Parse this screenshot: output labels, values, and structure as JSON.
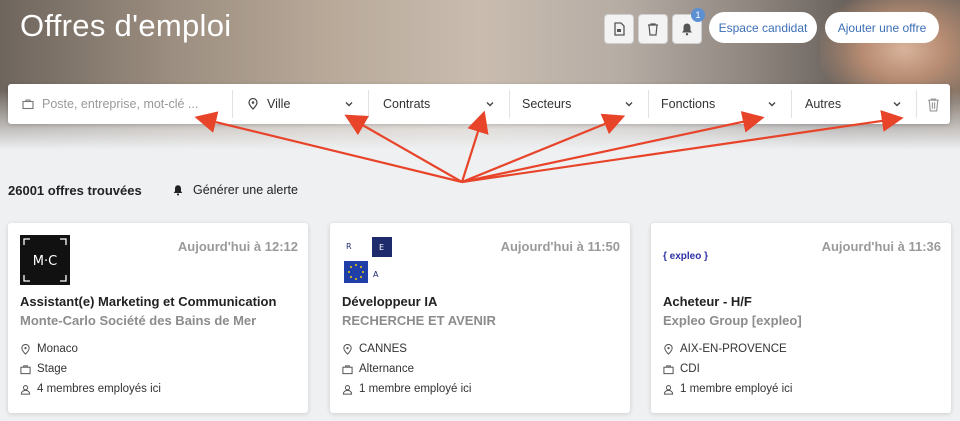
{
  "header": {
    "title": "Offres d'emploi",
    "notification_count": "1",
    "candidate_space_label": "Espace candidat",
    "add_offer_label": "Ajouter une offre"
  },
  "search": {
    "keyword_placeholder": "Poste, entreprise, mot-clé ...",
    "city_label": "Ville",
    "contracts_label": "Contrats",
    "sectors_label": "Secteurs",
    "functions_label": "Fonctions",
    "others_label": "Autres"
  },
  "results": {
    "count_text": "26001 offres trouvées",
    "alert_label": "Générer une alerte"
  },
  "cards": [
    {
      "logo_text": "M·C",
      "time": "Aujourd'hui à 12:12",
      "title": "Assistant(e) Marketing et Communication",
      "company": "Monte-Carlo Société des Bains de Mer",
      "location": "Monaco",
      "contract": "Stage",
      "employees": "4 membres employés ici"
    },
    {
      "logo_text": "R E A",
      "time": "Aujourd'hui à 11:50",
      "title": "Développeur IA",
      "company": "RECHERCHE ET AVENIR",
      "location": "CANNES",
      "contract": "Alternance",
      "employees": "1 membre employé ici"
    },
    {
      "logo_text": "{ expleo }",
      "time": "Aujourd'hui à 11:36",
      "title": "Acheteur - H/F",
      "company": "Expleo Group [expleo]",
      "location": "AIX-EN-PROVENCE",
      "contract": "CDI",
      "employees": "1 membre employé ici"
    }
  ],
  "colors": {
    "accent": "#3c6fb7",
    "annotation_arrow": "#e8442a",
    "badge": "#5d8fd3"
  },
  "icons": [
    "file-pdf-icon",
    "trash-icon",
    "bell-icon",
    "briefcase-icon",
    "map-pin-icon",
    "chevron-down-icon",
    "user-icon"
  ]
}
